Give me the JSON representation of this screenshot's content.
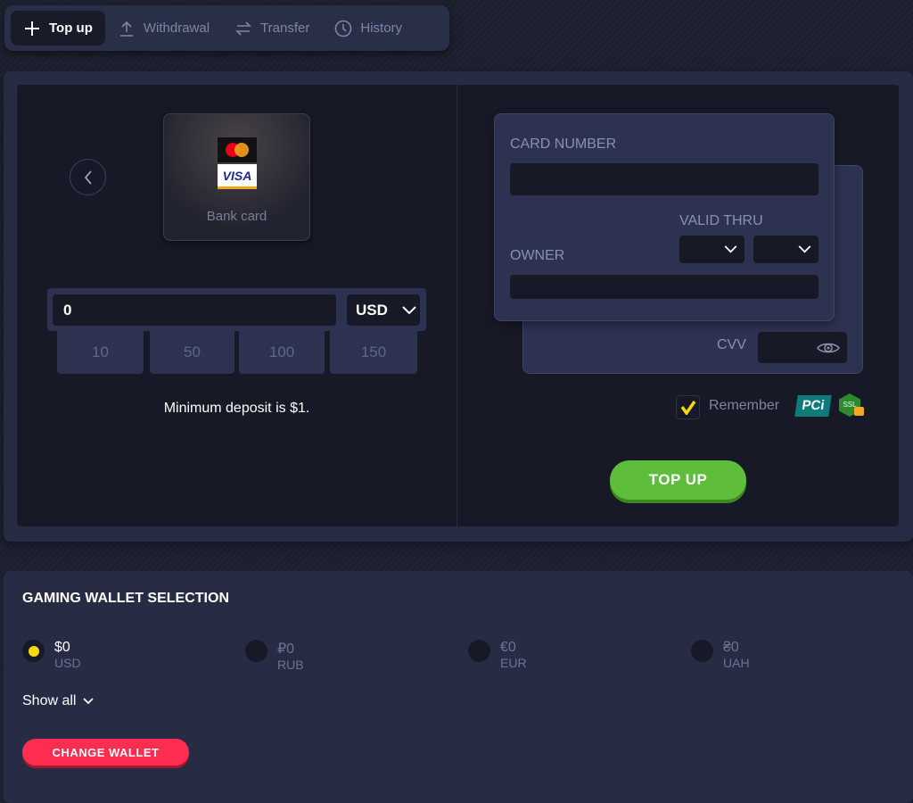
{
  "tabs": [
    {
      "label": "Top up",
      "icon": "plus-icon",
      "active": true
    },
    {
      "label": "Withdrawal",
      "icon": "upload-icon"
    },
    {
      "label": "Transfer",
      "icon": "transfer-icon"
    },
    {
      "label": "History",
      "icon": "clock-icon"
    }
  ],
  "method": {
    "label": "Bank card",
    "brands": [
      "mastercard",
      "VISA"
    ]
  },
  "amount": {
    "value": "0",
    "currency": "USD",
    "quick": [
      "10",
      "50",
      "100",
      "150"
    ],
    "min_note": "Minimum deposit is $1."
  },
  "card": {
    "number_label": "CARD NUMBER",
    "valid_label": "VALID THRU",
    "owner_label": "OWNER",
    "cvv_label": "CVV"
  },
  "remember": {
    "label": "Remember",
    "checked": true,
    "pci": "PCi",
    "ssl": "SSL"
  },
  "topup_label": "TOP UP",
  "wallet": {
    "title": "GAMING WALLET SELECTION",
    "items": [
      {
        "amount": "$0",
        "currency": "USD",
        "selected": true
      },
      {
        "amount": "₽0",
        "currency": "RUB"
      },
      {
        "amount": "€0",
        "currency": "EUR"
      },
      {
        "amount": "₴0",
        "currency": "UAH"
      }
    ],
    "show_all": "Show all",
    "change_label": "CHANGE WALLET"
  },
  "colors": {
    "green": "#5fbd3c",
    "red": "#ff2d4f",
    "yellow": "#f5d90a"
  }
}
